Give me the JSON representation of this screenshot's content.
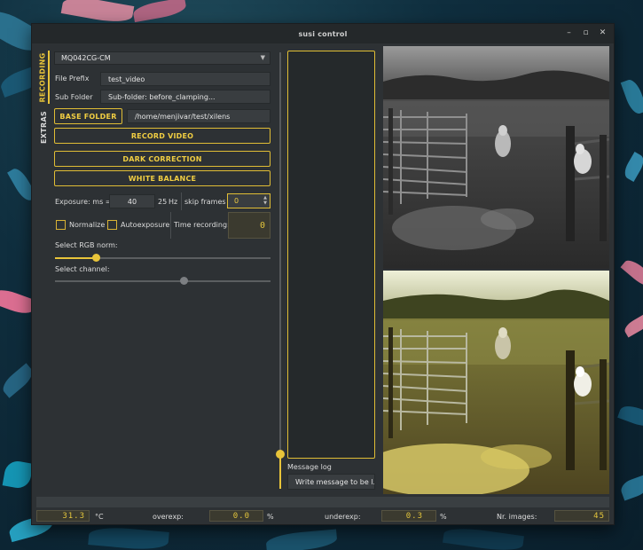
{
  "window": {
    "title": "susi control"
  },
  "window_controls": {
    "minimize": "–",
    "maximize": "▫",
    "close": "✕"
  },
  "tabs": {
    "recording": "RECORDING",
    "extras": "EXTRAS"
  },
  "camera_select": {
    "value": "MQ042CG-CM"
  },
  "file_prefix": {
    "label": "File Prefix",
    "value": "test_video"
  },
  "sub_folder": {
    "label": "Sub Folder",
    "value": "Sub-folder: before_clamping..."
  },
  "base_folder": {
    "button": "BASE FOLDER",
    "path": "/home/menjivar/test/xilens"
  },
  "buttons": {
    "record_video": "RECORD VIDEO",
    "dark_correction": "DARK CORRECTION",
    "white_balance": "WHITE BALANCE"
  },
  "exposure": {
    "label": "Exposure: ms =",
    "value": "40",
    "rate": "25",
    "rate_unit": "Hz"
  },
  "skip_frames": {
    "label": "skip frames",
    "value": "0"
  },
  "checkboxes": {
    "normalize": "Normalize",
    "autoexposure": "Autoexposure"
  },
  "time_recording": {
    "label": "Time recording:",
    "value": "0"
  },
  "rgb_norm": {
    "label": "Select RGB norm:",
    "level": 0.19
  },
  "channel": {
    "label": "Select channel:",
    "level": 0.6
  },
  "message_log": {
    "label": "Message log",
    "placeholder": "Write message to be l..."
  },
  "status": {
    "temperature": "31.3",
    "temp_unit": "°C",
    "overexp_label": "overexp:",
    "overexp": "0.0",
    "overexp_unit": "%",
    "underexp_label": "underexp:",
    "underexp": "0.3",
    "underexp_unit": "%",
    "nr_images_label": "Nr. images:",
    "nr_images": "45"
  },
  "colors": {
    "accent": "#e8c43a",
    "window_bg": "#2d3134",
    "field_bg": "#393d40",
    "lcd_bg": "#3b3a2f"
  },
  "icons": {
    "combo_arrow": "chevron-down-icon"
  }
}
